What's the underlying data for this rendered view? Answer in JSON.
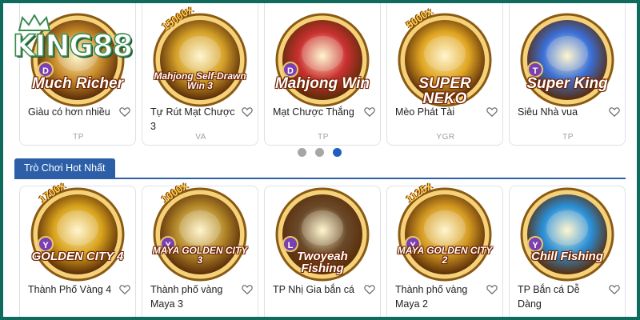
{
  "brand": {
    "logo_text": "KING88"
  },
  "top_games": [
    {
      "art_title": "Much Richer",
      "art_badge": "D",
      "art_corner": "",
      "name": "Giàu có hơn nhiều",
      "provider": "TP",
      "color": "#c88b2a"
    },
    {
      "art_title": "Mahjong Self-Drawn Win 3",
      "art_badge": "",
      "art_corner": "15000x",
      "name": "Tự Rút Mạt Chược 3",
      "provider": "VA",
      "color": "#d4a028"
    },
    {
      "art_title": "Mahjong Win",
      "art_badge": "D",
      "art_corner": "",
      "name": "Mạt Chược Thắng",
      "provider": "TP",
      "color": "#c93030"
    },
    {
      "art_title": "SUPER NEKO",
      "art_badge": "",
      "art_corner": "5000x",
      "name": "Mèo Phát Tài",
      "provider": "YGR",
      "color": "#e0a522"
    },
    {
      "art_title": "Super King",
      "art_badge": "T",
      "art_corner": "",
      "name": "Siêu Nhà vua",
      "provider": "TP",
      "color": "#3a6fd8"
    }
  ],
  "carousel": {
    "count": 3,
    "active_index": 2
  },
  "section": {
    "title": "Trò Chơi Hot Nhất"
  },
  "hot_games": [
    {
      "art_title": "GOLDEN CITY 4",
      "art_badge": "Y",
      "art_corner": "1700x",
      "name": "Thành Phố Vàng 4",
      "color": "#d8a21c"
    },
    {
      "art_title": "MAYA GOLDEN CITY 3",
      "art_badge": "Y",
      "art_corner": "1000x",
      "name": "Thành phố vàng Maya 3",
      "color": "#b58a2a"
    },
    {
      "art_title": "Twoyeah Fishing",
      "art_badge": "L",
      "art_corner": "",
      "name": "TP Nhị Gia bắn cá",
      "color": "#6a4a2a"
    },
    {
      "art_title": "MAYA GOLDEN CITY 2",
      "art_badge": "Y",
      "art_corner": "1125x",
      "name": "Thành phố vàng Maya 2",
      "color": "#d49a22"
    },
    {
      "art_title": "Chill Fishing",
      "art_badge": "Y",
      "art_corner": "",
      "name": "TP Bắn cá Dễ Dàng",
      "color": "#2a8fd8"
    }
  ]
}
